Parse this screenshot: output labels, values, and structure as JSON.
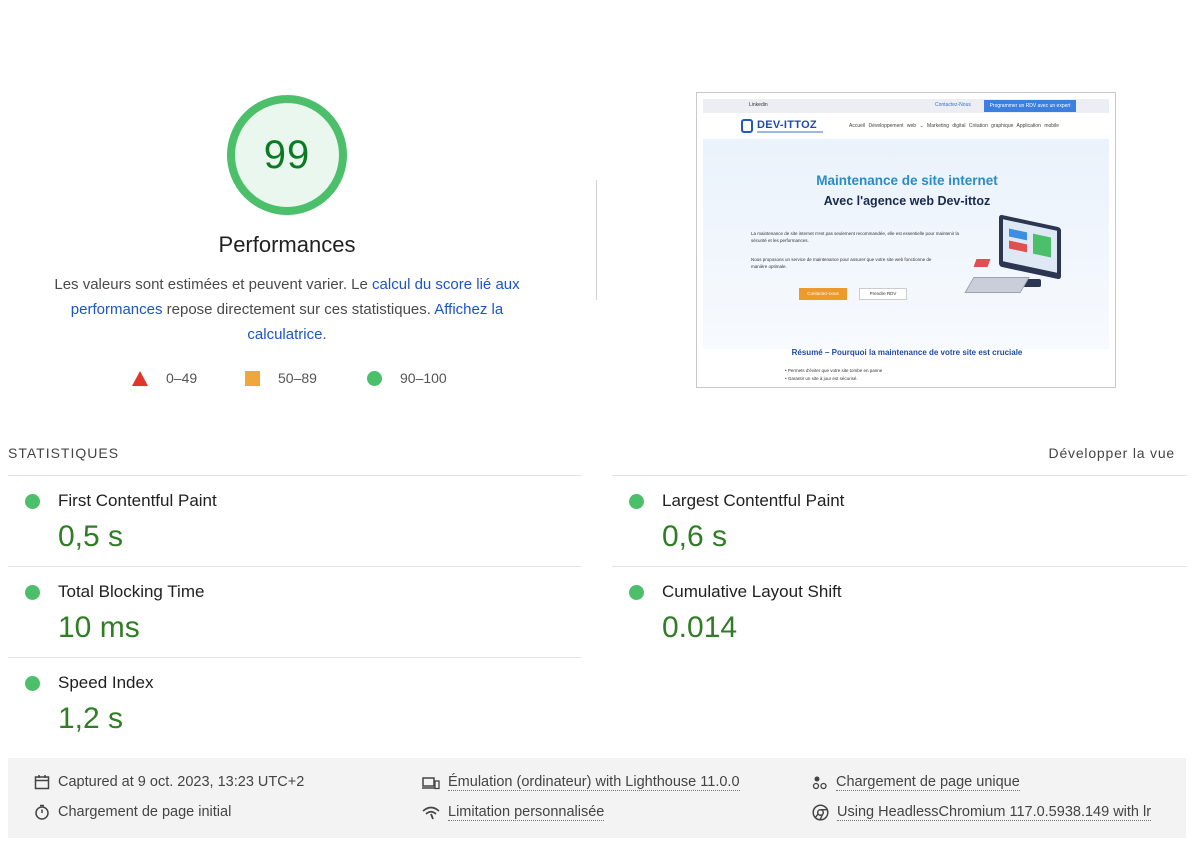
{
  "gauge": {
    "score": "99",
    "score_fraction": 0.99,
    "title": "Performances",
    "color": "#4bbf6a"
  },
  "description": {
    "text_before": "Les valeurs sont estimées et peuvent varier. Le ",
    "link1": "calcul du score lié aux performances",
    "text_middle": " repose directement sur ces statistiques. ",
    "link2": "Affichez la calculatrice",
    "text_after": "."
  },
  "legend": [
    {
      "label": "0–49",
      "icon": "red-triangle-icon",
      "color": "#e0362c"
    },
    {
      "label": "50–89",
      "icon": "orange-square-icon",
      "color": "#f0a63a"
    },
    {
      "label": "90–100",
      "icon": "green-circle-icon",
      "color": "#4bbf6a"
    }
  ],
  "screenshot": {
    "linkedin": "Linkedin",
    "contact": "Contactez-Nous",
    "rdv_button": "Programmer un RDV avec un expert",
    "logo": "DEV-ITTOZ",
    "menu": "Accueil   Développement web ⌄   Marketing digital   Création graphique   Application mobile",
    "hero_title": "Maintenance de site internet",
    "hero_subtitle": "Avec l'agence web Dev-ittoz",
    "para1": "La maintenance de site internet n'est pas seulement recommandée, elle est essentielle pour maintenir la sécurité et les performances.",
    "para2": "Nous proposons un service de maintenance pour assurer que votre site web fonctionne de manière optimale.",
    "button1": "Contactez-nous",
    "button2": "Prendre RDV",
    "section_title": "Résumé – Pourquoi la maintenance de votre site est cruciale",
    "bullet1": "•  Permets d'éviter que votre site tombe en panne",
    "bullet2": "•  Garantir un site à jour est sécurisé."
  },
  "stats": {
    "header": "STATISTIQUES",
    "expand": "Développer la vue",
    "metrics": [
      {
        "name": "First Contentful Paint",
        "value": "0,5 s"
      },
      {
        "name": "Largest Contentful Paint",
        "value": "0,6 s"
      },
      {
        "name": "Total Blocking Time",
        "value": "10 ms"
      },
      {
        "name": "Cumulative Layout Shift",
        "value": "0.014"
      },
      {
        "name": "Speed Index",
        "value": "1,2 s"
      }
    ]
  },
  "footer": {
    "captured": "Captured at 9 oct. 2023, 13:23 UTC+2",
    "initial_load": "Chargement de page initial",
    "emulation": "Émulation (ordinateur) with Lighthouse 11.0.0",
    "throttling": "Limitation personnalisée",
    "single_load": "Chargement de page unique",
    "browser": "Using HeadlessChromium 117.0.5938.149 with lr"
  }
}
